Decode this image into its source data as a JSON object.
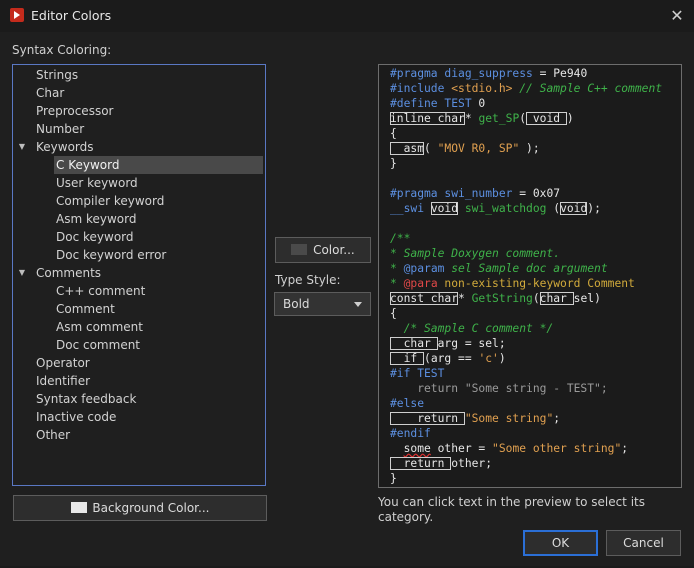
{
  "window": {
    "title": "Editor Colors",
    "close_glyph": "✕"
  },
  "syntax_label": "Syntax Coloring:",
  "tree": [
    {
      "label": "Strings"
    },
    {
      "label": "Char"
    },
    {
      "label": "Preprocessor"
    },
    {
      "label": "Number"
    },
    {
      "label": "Keywords",
      "expanded": true
    },
    {
      "label": "C Keyword",
      "selected": true
    },
    {
      "label": "User keyword"
    },
    {
      "label": "Compiler keyword"
    },
    {
      "label": "Asm keyword"
    },
    {
      "label": "Doc keyword"
    },
    {
      "label": "Doc keyword error"
    },
    {
      "label": "Comments",
      "expanded": true
    },
    {
      "label": "C++ comment"
    },
    {
      "label": "Comment"
    },
    {
      "label": "Asm comment"
    },
    {
      "label": "Doc comment"
    },
    {
      "label": "Operator"
    },
    {
      "label": "Identifier"
    },
    {
      "label": "Syntax feedback"
    },
    {
      "label": "Inactive code"
    },
    {
      "label": "Other"
    }
  ],
  "color_button": "Color...",
  "type_style_label": "Type Style:",
  "type_style_value": "Bold",
  "background_button": "Background Color...",
  "hint": "You can click text in the preview to select its category.",
  "ok_button": "OK",
  "cancel_button": "Cancel",
  "colors": {
    "accent": "#2b6fd6",
    "tree_border": "#5a78c4",
    "selected_bg": "#494949",
    "color_swatch": "#4a4a4a",
    "bg_swatch": "#e8e8e8"
  },
  "icons": {
    "app": "run-icon",
    "close": "close-icon",
    "expand": "caret-down-icon",
    "dropdown": "chevron-down-icon"
  },
  "code": [
    [
      {
        "t": "#pragma diag_suppress ",
        "c": "pp"
      },
      {
        "t": "= ",
        "c": "k"
      },
      {
        "t": "Pe940",
        "c": "k"
      }
    ],
    [
      {
        "t": "#include ",
        "c": "pp"
      },
      {
        "t": "<stdio.h>",
        "c": "str"
      },
      {
        "t": " // Sample C++ comment",
        "c": "cm"
      }
    ],
    [
      {
        "t": "#define TEST ",
        "c": "pp"
      },
      {
        "t": "0",
        "c": "k"
      }
    ],
    [
      {
        "t": "inline char",
        "c": "k",
        "b": 1
      },
      {
        "t": "* ",
        "c": "k"
      },
      {
        "t": "get_SP",
        "c": "fn"
      },
      {
        "t": "(",
        "c": "k"
      },
      {
        "t": " void ",
        "c": "k",
        "b": 1
      },
      {
        "t": ")",
        "c": "k"
      }
    ],
    [
      {
        "t": "{",
        "c": "k"
      }
    ],
    [
      {
        "t": "  asm",
        "c": "k",
        "b": 1
      },
      {
        "t": "( ",
        "c": "k"
      },
      {
        "t": "\"MOV R0, SP\"",
        "c": "str"
      },
      {
        "t": " );",
        "c": "k"
      }
    ],
    [
      {
        "t": "}",
        "c": "k"
      }
    ],
    [],
    [
      {
        "t": "#pragma swi_number ",
        "c": "pp"
      },
      {
        "t": "= 0x07",
        "c": "k"
      }
    ],
    [
      {
        "t": "__swi ",
        "c": "pp"
      },
      {
        "t": "void",
        "c": "k",
        "b": 1
      },
      {
        "t": " swi_watchdog ",
        "c": "fn"
      },
      {
        "t": "(",
        "c": "k"
      },
      {
        "t": "void",
        "c": "k",
        "b": 1
      },
      {
        "t": ");",
        "c": "k"
      }
    ],
    [],
    [
      {
        "t": "/**",
        "c": "cm"
      }
    ],
    [
      {
        "t": "* Sample Doxygen comment.",
        "c": "cm"
      }
    ],
    [
      {
        "t": "* ",
        "c": "cm"
      },
      {
        "t": "@param",
        "c": "dkw"
      },
      {
        "t": " sel Sample doc argument",
        "c": "cm"
      }
    ],
    [
      {
        "t": "* ",
        "c": "cm"
      },
      {
        "t": "@para",
        "c": "dke"
      },
      {
        "t": " non-existing-keyword Comment",
        "c": "doc"
      }
    ],
    [
      {
        "t": "const char",
        "c": "k",
        "b": 1
      },
      {
        "t": "* ",
        "c": "k"
      },
      {
        "t": "GetString",
        "c": "fn"
      },
      {
        "t": "(",
        "c": "k"
      },
      {
        "t": "char ",
        "c": "k",
        "b": 1
      },
      {
        "t": "sel)",
        "c": "k"
      }
    ],
    [
      {
        "t": "{",
        "c": "k"
      }
    ],
    [
      {
        "t": "  /* Sample C comment */",
        "c": "cm"
      }
    ],
    [
      {
        "t": "  char ",
        "c": "k",
        "b": 1
      },
      {
        "t": "arg = sel;",
        "c": "k"
      }
    ],
    [
      {
        "t": "  if ",
        "c": "k",
        "b": 1
      },
      {
        "t": "(arg == ",
        "c": "k"
      },
      {
        "t": "'c'",
        "c": "str"
      },
      {
        "t": ")",
        "c": "k"
      }
    ],
    [
      {
        "t": "#if TEST",
        "c": "pp"
      }
    ],
    [
      {
        "t": "    return \"Some string - TEST\";",
        "c": "k",
        "dim": 1
      }
    ],
    [
      {
        "t": "#else",
        "c": "pp"
      }
    ],
    [
      {
        "t": "    return ",
        "c": "k",
        "b": 1
      },
      {
        "t": "\"Some string\"",
        "c": "str"
      },
      {
        "t": ";",
        "c": "k"
      }
    ],
    [
      {
        "t": "#endif",
        "c": "pp"
      }
    ],
    [
      {
        "t": "  ",
        "c": "k"
      },
      {
        "t": "some",
        "c": "k",
        "err": 1
      },
      {
        "t": " other = ",
        "c": "k"
      },
      {
        "t": "\"Some other string\"",
        "c": "str"
      },
      {
        "t": ";",
        "c": "k"
      }
    ],
    [
      {
        "t": "  return ",
        "c": "k",
        "b": 1
      },
      {
        "t": "other;",
        "c": "k"
      }
    ],
    [
      {
        "t": "}",
        "c": "k"
      }
    ]
  ]
}
